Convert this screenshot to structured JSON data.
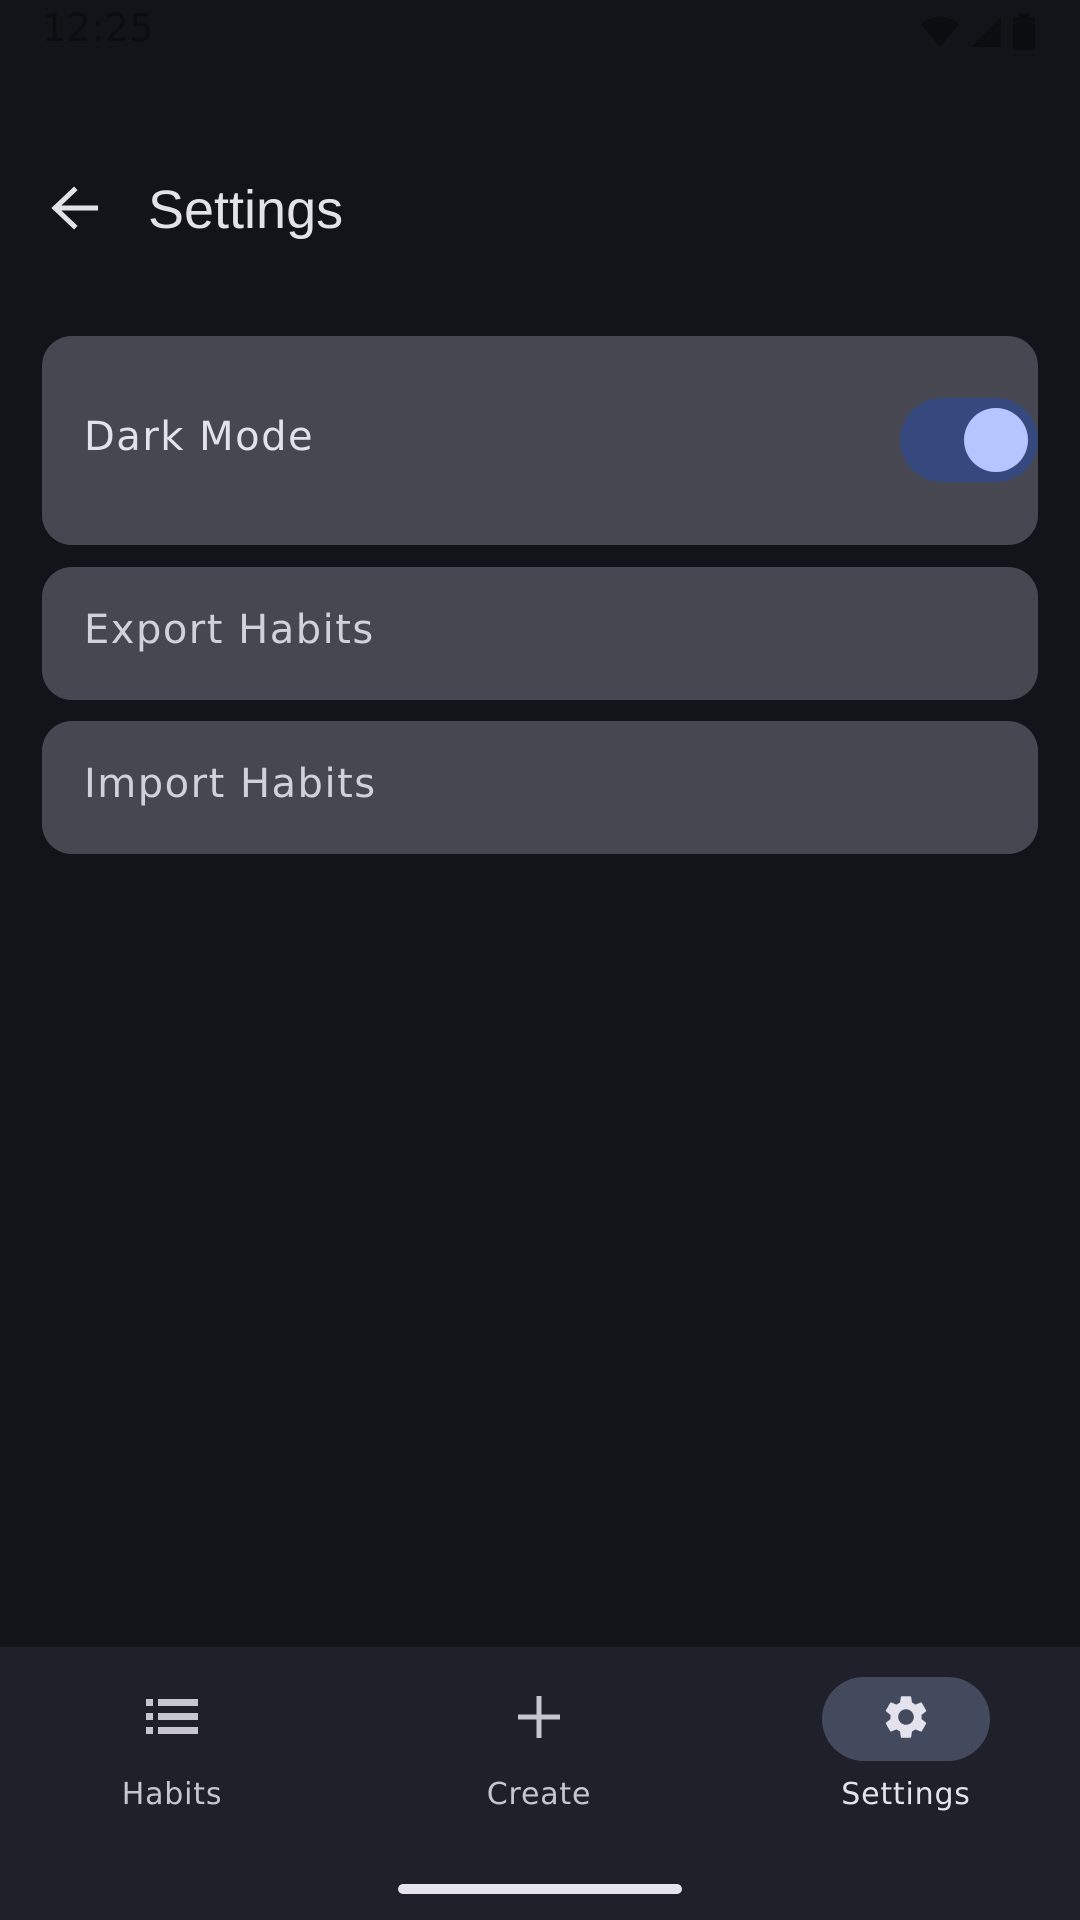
{
  "status_bar": {
    "time": "12:25",
    "icons": [
      "wifi-icon",
      "cellular-signal-icon",
      "battery-icon"
    ]
  },
  "top_bar": {
    "back_icon": "arrow-back-icon",
    "title": "Settings"
  },
  "settings": {
    "dark_mode": {
      "label": "Dark Mode",
      "enabled": true
    },
    "export_label": "Export Habits",
    "import_label": "Import Habits"
  },
  "bottom_nav": {
    "items": [
      {
        "label": "Habits",
        "icon": "list-icon",
        "active": false
      },
      {
        "label": "Create",
        "icon": "plus-icon",
        "active": false
      },
      {
        "label": "Settings",
        "icon": "gear-icon",
        "active": true
      }
    ]
  },
  "colors": {
    "background": "#131419",
    "card": "#474752",
    "switch_track": "#36497f",
    "switch_thumb": "#b6c4ff",
    "nav_background": "#1f2029",
    "nav_active_indicator": "#444a5e"
  }
}
